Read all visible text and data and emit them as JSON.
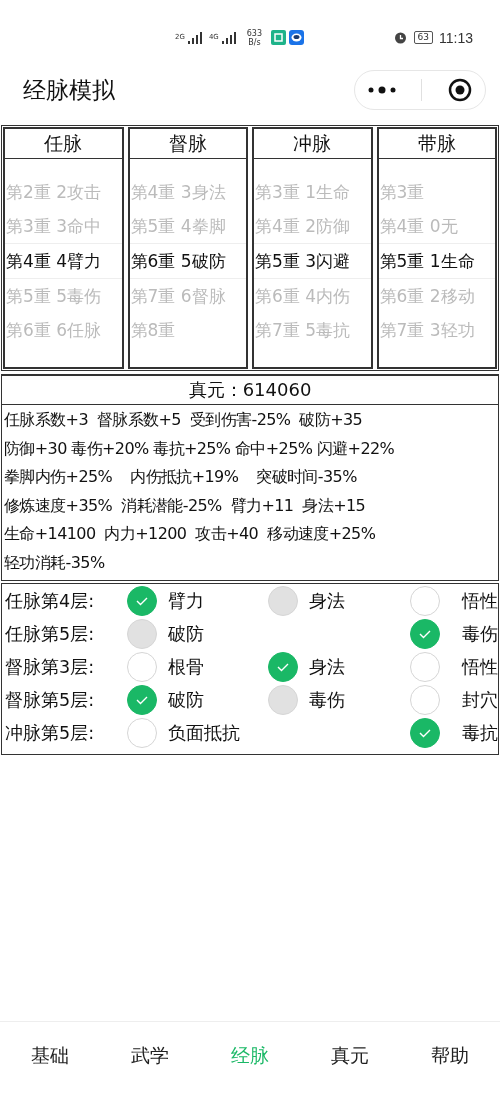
{
  "status_bar": {
    "network_1": "2G",
    "network_2": "4G",
    "speed": "633",
    "speed_unit": "B/s",
    "battery": "63",
    "time": "11:13"
  },
  "title": "经脉模拟",
  "pickers": [
    {
      "header": "任脉",
      "rows": [
        {
          "text": "第2重 2攻击",
          "selected": false
        },
        {
          "text": "第3重 3命中",
          "selected": false
        },
        {
          "text": "第4重 4臂力",
          "selected": true
        },
        {
          "text": "第5重 5毒伤",
          "selected": false
        },
        {
          "text": "第6重 6任脉",
          "selected": false
        }
      ]
    },
    {
      "header": "督脉",
      "rows": [
        {
          "text": "第4重 3身法",
          "selected": false
        },
        {
          "text": "第5重 4拳脚",
          "selected": false
        },
        {
          "text": "第6重 5破防",
          "selected": true
        },
        {
          "text": "第7重 6督脉",
          "selected": false
        },
        {
          "text": "第8重",
          "selected": false
        }
      ]
    },
    {
      "header": "冲脉",
      "rows": [
        {
          "text": "第3重 1生命",
          "selected": false
        },
        {
          "text": "第4重 2防御",
          "selected": false
        },
        {
          "text": "第5重 3闪避",
          "selected": true
        },
        {
          "text": "第6重 4内伤",
          "selected": false
        },
        {
          "text": "第7重 5毒抗",
          "selected": false
        }
      ]
    },
    {
      "header": "带脉",
      "rows": [
        {
          "text": "第3重",
          "selected": false
        },
        {
          "text": "第4重 0无",
          "selected": false
        },
        {
          "text": "第5重 1生命",
          "selected": true
        },
        {
          "text": "第6重 2移动",
          "selected": false
        },
        {
          "text": "第7重 3轻功",
          "selected": false
        }
      ]
    }
  ],
  "zhenyuan": "真元：614060",
  "bonuses": [
    "任脉系数+3  督脉系数+5  受到伤害-25%  破防+35",
    "防御+30 毒伤+20% 毒抗+25% 命中+25% 闪避+22%",
    "拳脚内伤+25%    内伤抵抗+19%    突破时间-35%",
    "修炼速度+35%  消耗潜能-25%  臂力+11  身法+15",
    "生命+14100  内力+1200  攻击+40  移动速度+25%",
    "轻功消耗-35%"
  ],
  "choices": [
    {
      "label": "任脉第4层:",
      "options": [
        {
          "kind": "radio",
          "text": "臂力",
          "checked": true,
          "disabled": false
        },
        {
          "kind": "radio",
          "text": "身法",
          "checked": false,
          "disabled": true
        },
        {
          "kind": "radio",
          "text": "悟性",
          "checked": false,
          "disabled": false
        }
      ]
    },
    {
      "label": "任脉第5层:",
      "options": [
        {
          "kind": "radio",
          "text": "破防",
          "checked": false,
          "disabled": true
        },
        {
          "kind": "blank"
        },
        {
          "kind": "radio",
          "text": "毒伤",
          "checked": true,
          "disabled": false
        }
      ]
    },
    {
      "label": "督脉第3层:",
      "options": [
        {
          "kind": "radio",
          "text": "根骨",
          "checked": false,
          "disabled": false
        },
        {
          "kind": "radio",
          "text": "身法",
          "checked": true,
          "disabled": false
        },
        {
          "kind": "radio",
          "text": "悟性",
          "checked": false,
          "disabled": false
        }
      ]
    },
    {
      "label": "督脉第5层:",
      "options": [
        {
          "kind": "radio",
          "text": "破防",
          "checked": true,
          "disabled": false
        },
        {
          "kind": "radio",
          "text": "毒伤",
          "checked": false,
          "disabled": true
        },
        {
          "kind": "radio",
          "text": "封穴",
          "checked": false,
          "disabled": false
        }
      ]
    },
    {
      "label": "冲脉第5层:",
      "options": [
        {
          "kind": "radio",
          "text": "负面抵抗",
          "checked": false,
          "disabled": false
        },
        {
          "kind": "blank"
        },
        {
          "kind": "radio",
          "text": "毒抗",
          "checked": true,
          "disabled": false
        }
      ]
    }
  ],
  "tabs": [
    {
      "label": "基础",
      "selected": false
    },
    {
      "label": "武学",
      "selected": false
    },
    {
      "label": "经脉",
      "selected": true
    },
    {
      "label": "真元",
      "selected": false
    },
    {
      "label": "帮助",
      "selected": false
    }
  ]
}
